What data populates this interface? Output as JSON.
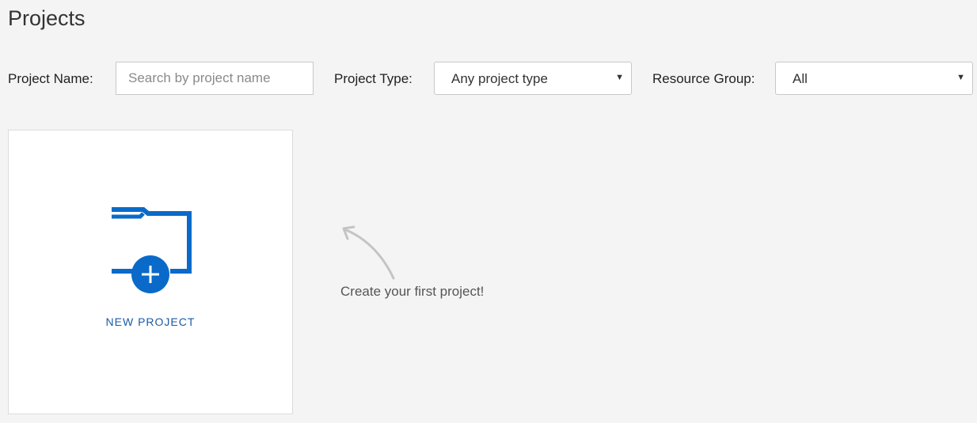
{
  "header": {
    "title": "Projects"
  },
  "filters": {
    "project_name_label": "Project Name:",
    "project_name_placeholder": "Search by project name",
    "project_name_value": "",
    "project_type_label": "Project Type:",
    "project_type_value": "Any project type",
    "resource_group_label": "Resource Group:",
    "resource_group_value": "All"
  },
  "new_project": {
    "label": "NEW PROJECT",
    "icon": "folder-plus-icon",
    "accent_color": "#0a6ac9"
  },
  "hint": {
    "text": "Create your first project!"
  }
}
